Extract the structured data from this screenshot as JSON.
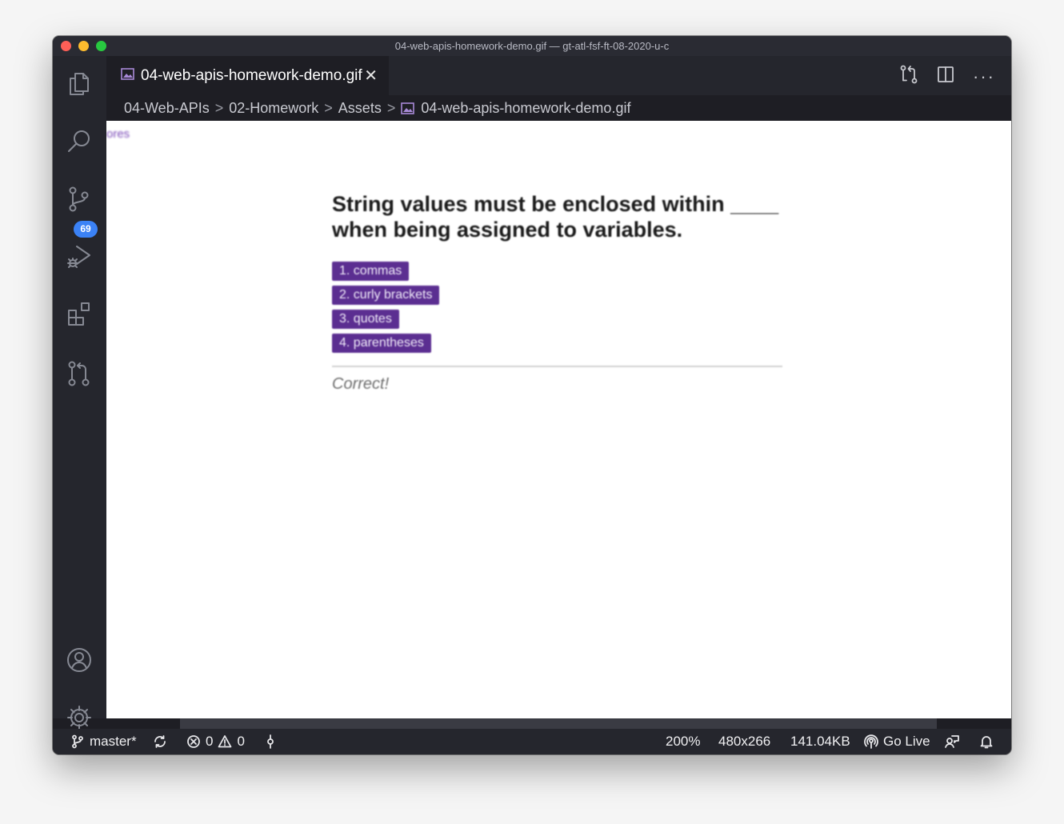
{
  "window": {
    "title": "04-web-apis-homework-demo.gif — gt-atl-fsf-ft-08-2020-u-c"
  },
  "activity_bar": {
    "items": [
      {
        "name": "explorer-icon"
      },
      {
        "name": "search-icon"
      },
      {
        "name": "source-control-icon",
        "badge": "69"
      },
      {
        "name": "run-debug-icon"
      },
      {
        "name": "extensions-icon"
      },
      {
        "name": "pull-requests-icon"
      }
    ],
    "bottom": [
      {
        "name": "account-icon"
      },
      {
        "name": "settings-gear-icon"
      }
    ]
  },
  "tab": {
    "label": "04-web-apis-homework-demo.gif",
    "close": "✕"
  },
  "editor_actions": {
    "more": "···"
  },
  "breadcrumb": {
    "items": [
      "04-Web-APIs",
      "02-Homework",
      "Assets",
      "04-web-apis-homework-demo.gif"
    ]
  },
  "preview": {
    "cutoff_text": "ores",
    "question_line1": "String values must be enclosed within ____",
    "question_line2": "when being assigned to variables.",
    "choices": [
      "1. commas",
      "2. curly brackets",
      "3. quotes",
      "4. parentheses"
    ],
    "result": "Correct!",
    "accent_color": "#5b2e91"
  },
  "status_bar": {
    "branch": "master*",
    "errors": "0",
    "warnings": "0",
    "zoom": "200%",
    "dimensions": "480x266",
    "file_size": "141.04KB",
    "go_live": "Go Live"
  }
}
